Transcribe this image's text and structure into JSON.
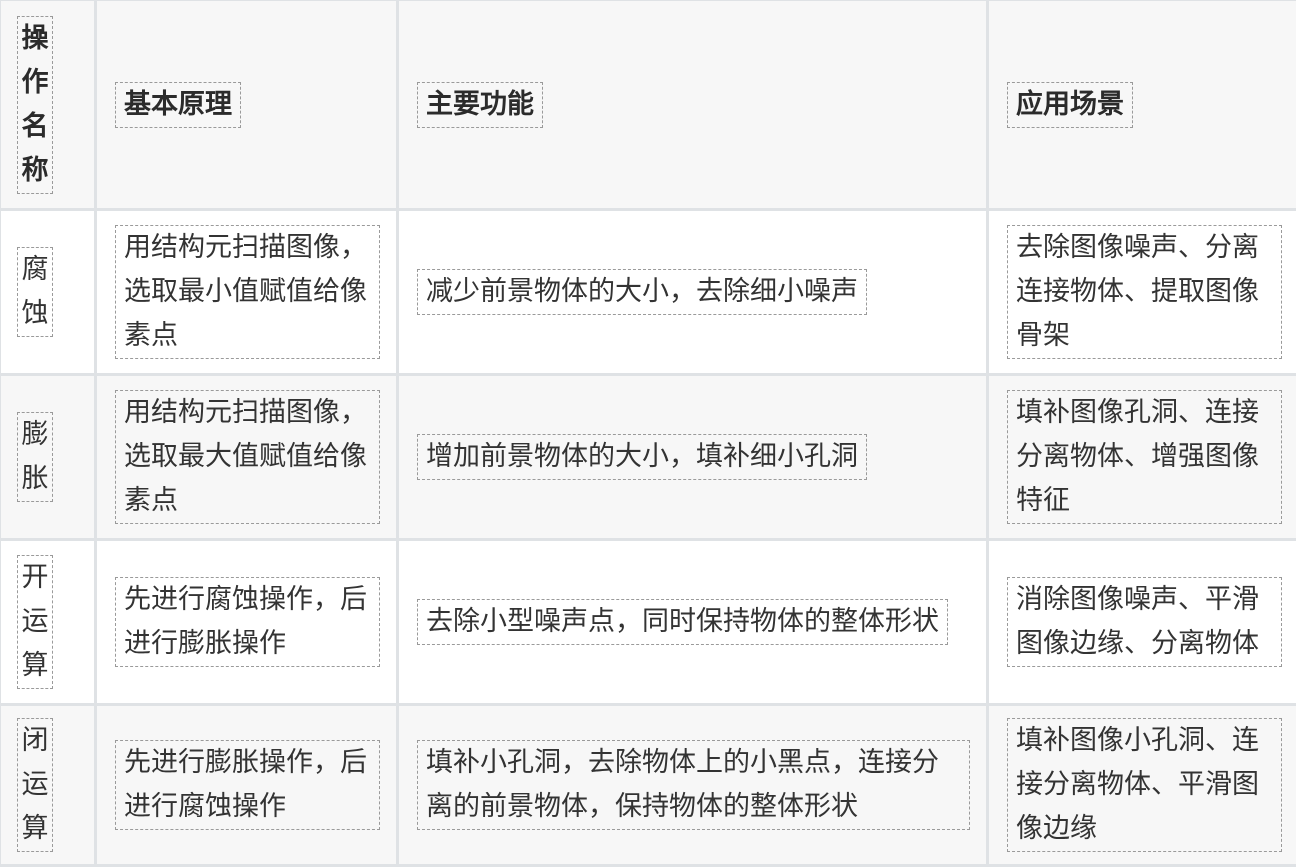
{
  "headers": {
    "name": [
      "操",
      "作",
      "名",
      "称"
    ],
    "principle": "基本原理",
    "function": "主要功能",
    "scenario": "应用场景"
  },
  "rows": [
    {
      "name": [
        "腐",
        "蚀"
      ],
      "principle": "用结构元扫描图像，选取最小值赋值给像素点",
      "function": "减少前景物体的大小，去除细小噪声",
      "scenario": "去除图像噪声、分离连接物体、提取图像骨架"
    },
    {
      "name": [
        "膨",
        "胀"
      ],
      "principle": "用结构元扫描图像，选取最大值赋值给像素点",
      "function": "增加前景物体的大小，填补细小孔洞",
      "scenario": "填补图像孔洞、连接分离物体、增强图像特征"
    },
    {
      "name": [
        "开",
        "运",
        "算"
      ],
      "principle": "先进行腐蚀操作，后进行膨胀操作",
      "function": "去除小型噪声点，同时保持物体的整体形状",
      "scenario": "消除图像噪声、平滑图像边缘、分离物体"
    },
    {
      "name": [
        "闭",
        "运",
        "算"
      ],
      "principle": "先进行膨胀操作，后进行腐蚀操作",
      "function": "填补小孔洞，去除物体上的小黑点，连接分离的前景物体，保持物体的整体形状",
      "scenario": "填补图像小孔洞、连接分离物体、平滑图像边缘"
    }
  ],
  "colors": {
    "border": "#dfe2e5",
    "dashed": "#9a9a9a",
    "stripe": "#f7f7f7",
    "text": "#333333"
  }
}
